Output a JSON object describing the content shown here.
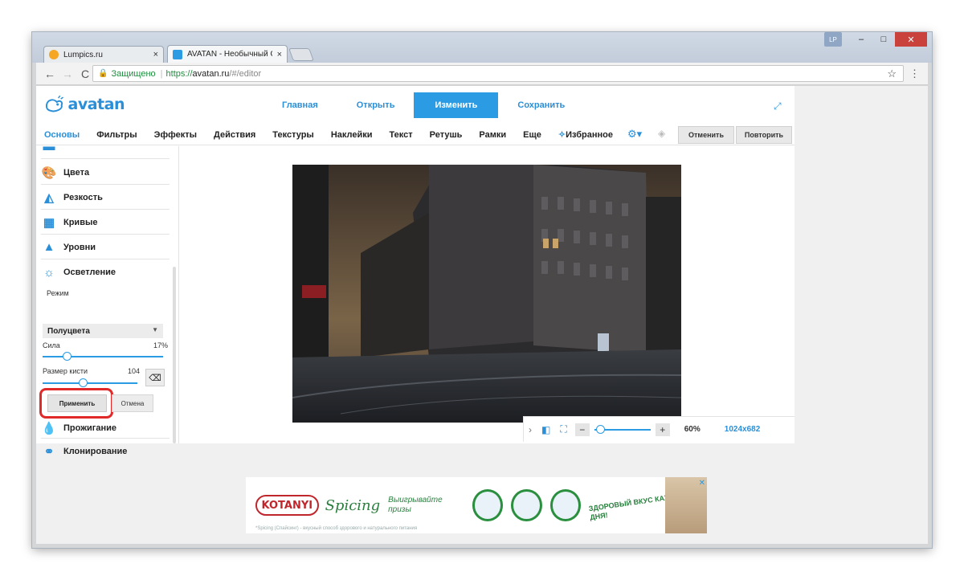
{
  "browser": {
    "tabs": [
      {
        "title": "Lumpics.ru",
        "close": "×"
      },
      {
        "title": "AVATAN - Необычный С",
        "close": "×"
      }
    ],
    "profile": "LP",
    "window_controls": {
      "minimize": "–",
      "maximize": "□",
      "close": "✕"
    },
    "nav": {
      "back": "←",
      "forward": "→",
      "reload": "C"
    },
    "address": {
      "secure_label": "Защищено",
      "scheme": "https://",
      "host": "avatan.ru",
      "path": "/#/editor"
    }
  },
  "app": {
    "logo": "avatan",
    "main_nav": [
      "Главная",
      "Открыть",
      "Изменить",
      "Сохранить"
    ],
    "sub_nav": [
      "Основы",
      "Фильтры",
      "Эффекты",
      "Действия",
      "Текстуры",
      "Наклейки",
      "Текст",
      "Ретушь",
      "Рамки",
      "Еще",
      "Избранное"
    ],
    "undo": "Отменить",
    "redo": "Повторить",
    "sidebar": {
      "items": [
        "Цвета",
        "Резкость",
        "Кривые",
        "Уровни",
        "Осветление"
      ],
      "mode_label": "Режим",
      "mode_value": "Полуцвета",
      "strength_label": "Сила",
      "strength_value": "17%",
      "strength_fraction": 0.2,
      "brush_label": "Размер кисти",
      "brush_value": "104",
      "brush_fraction": 0.42,
      "apply": "Применить",
      "cancel": "Отмена",
      "after": [
        "Прожигание",
        "Клонирование"
      ]
    },
    "zoom": {
      "minus": "−",
      "plus": "+",
      "percent": "60%",
      "resolution": "1024x682",
      "fraction": 0.1
    }
  },
  "ad": {
    "brand": "KOTANYI",
    "spicing": "Spicing",
    "promo": "Выигрывайте призы",
    "slogan": "ЗДОРОВЫЙ ВКУС КАЖДОГО ДНЯ!",
    "fine_print": "*Spicing (Спайсинг) - вкусный способ здорового и натурального питания",
    "close": "✕"
  }
}
